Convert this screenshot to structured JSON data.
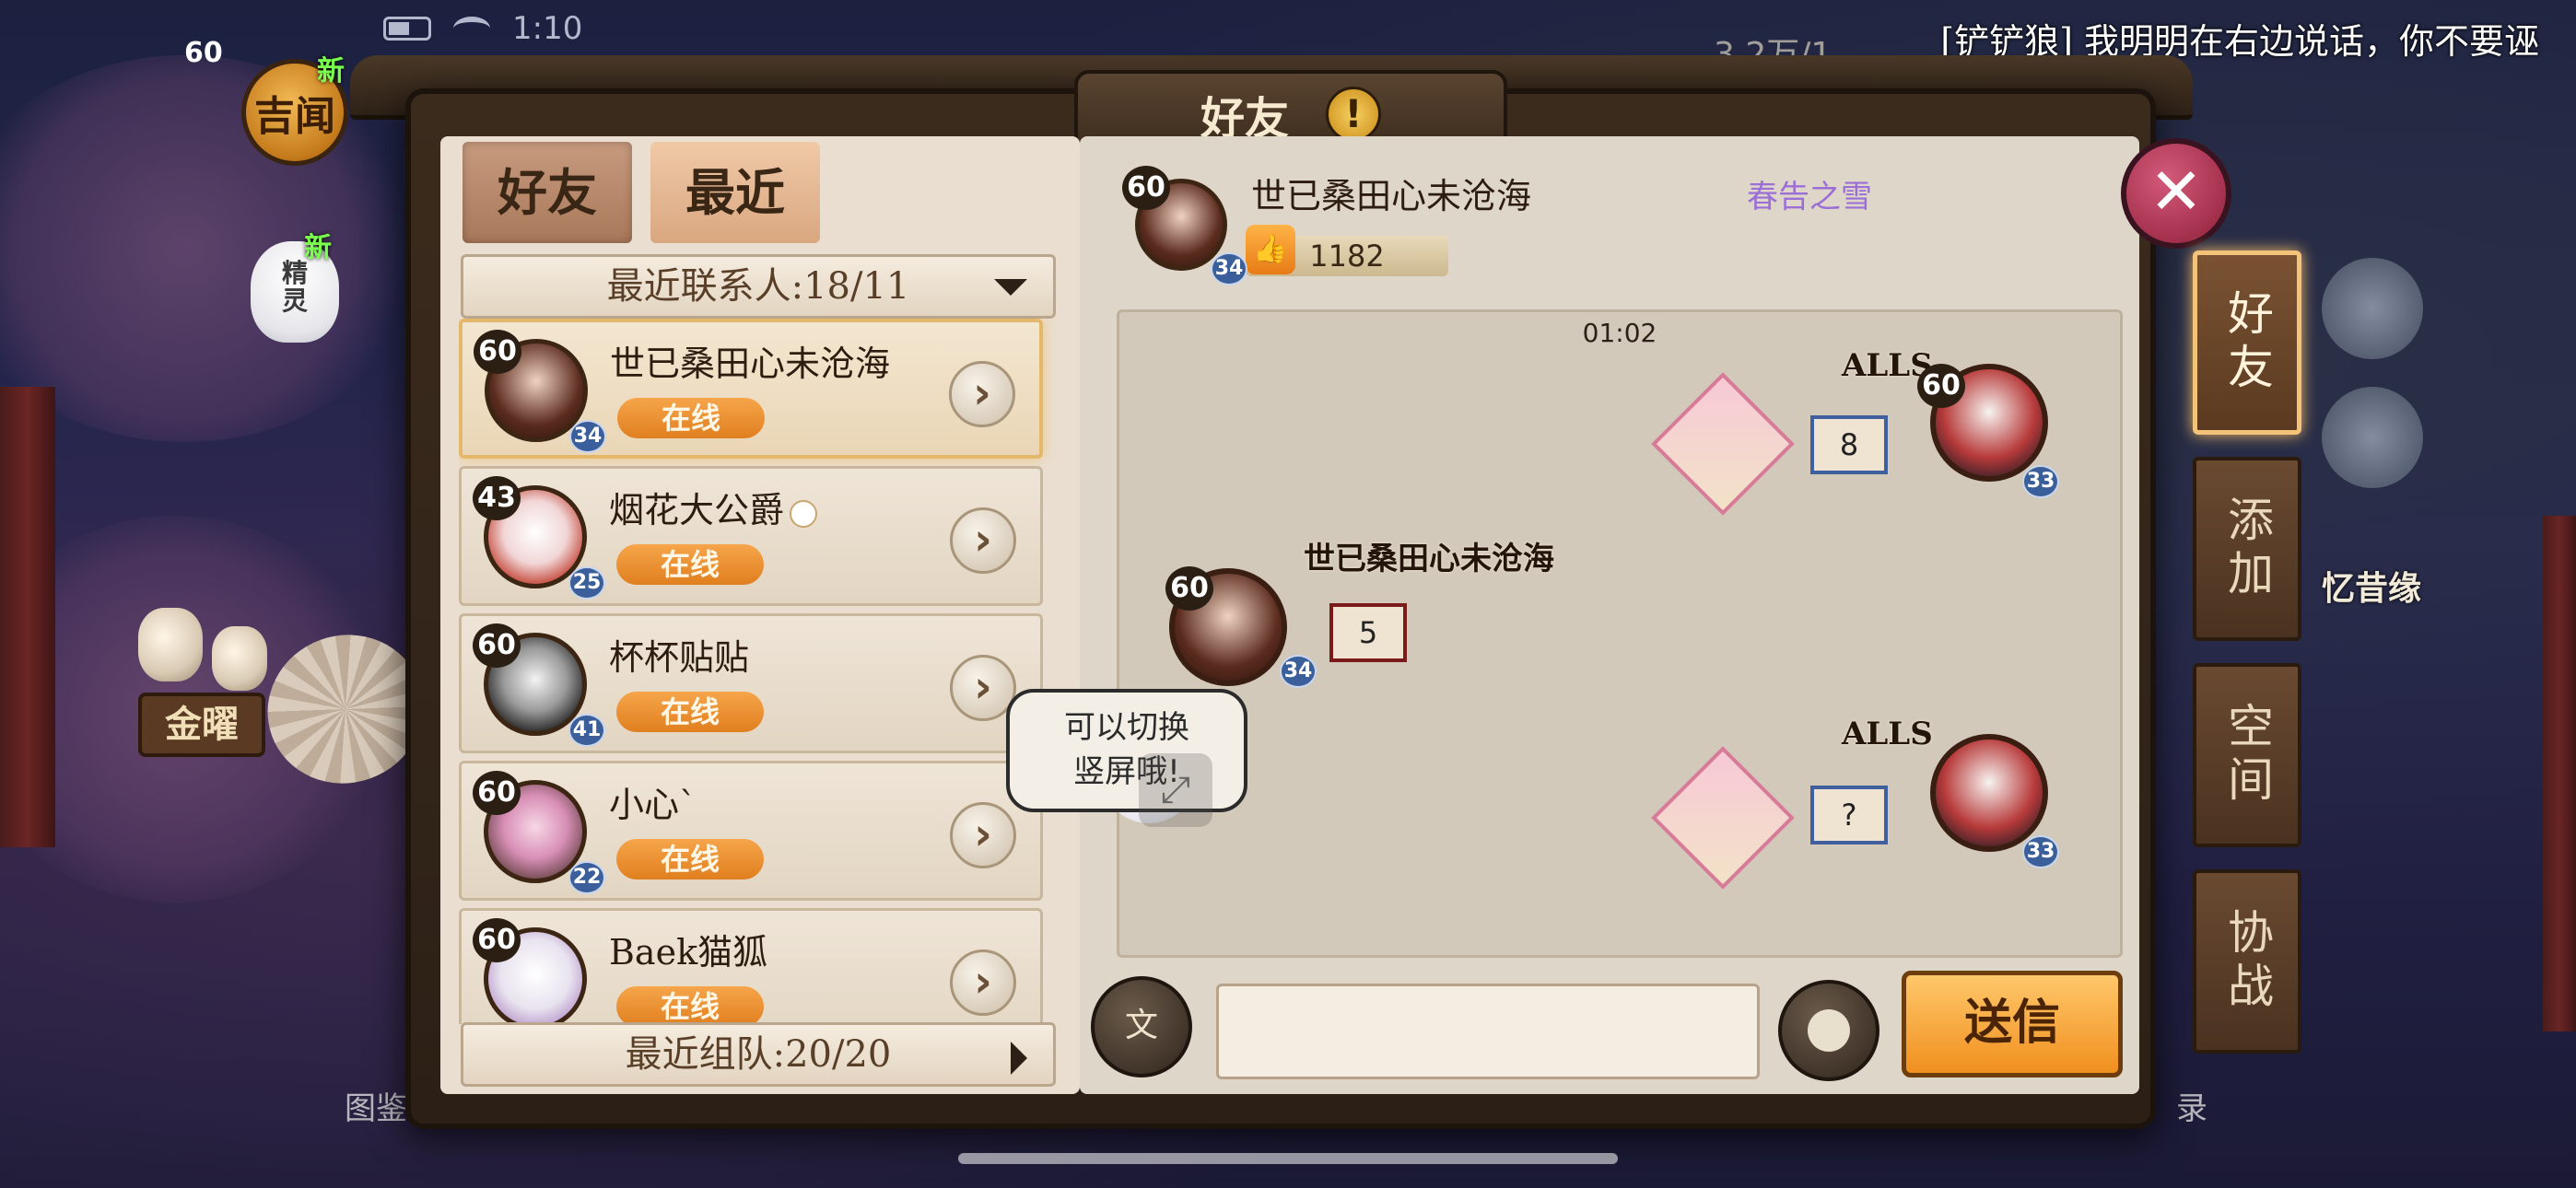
{
  "status_bar": {
    "time": "1:10"
  },
  "top_left": {
    "level": "60",
    "jiwen_label": "吉闻",
    "jiwen_new": "新",
    "spirit_label": "精\n灵",
    "spirit_new": "新"
  },
  "top_resource": "3.2万/1",
  "broadcast": "[铲铲狼] 我明明在右边说话，你不要诬",
  "background": {
    "sign_text": "金曜",
    "bottom_left_label": "图鉴",
    "right_label": "忆昔缘",
    "bottom_right_label": "录"
  },
  "dialog": {
    "title": "好友",
    "warn_symbol": "!",
    "close_symbol": "✕"
  },
  "left": {
    "tabs": [
      {
        "label": "好友",
        "active": false
      },
      {
        "label": "最近",
        "active": true
      }
    ],
    "recent_contacts_label": "最近联系人:18/11",
    "recent_team_label": "最近组队:20/20",
    "friends": [
      {
        "name": "世已桑田心未沧海",
        "level": "60",
        "sub_level": "34",
        "status": "在线",
        "selected": true
      },
      {
        "name": "烟花大公爵",
        "level": "43",
        "sub_level": "25",
        "status": "在线",
        "selected": false
      },
      {
        "name": "杯杯贴贴",
        "level": "60",
        "sub_level": "41",
        "status": "在线",
        "selected": false
      },
      {
        "name": "小心`",
        "level": "60",
        "sub_level": "22",
        "status": "在线",
        "selected": false
      },
      {
        "name": "Baek猫狐",
        "level": "60",
        "sub_level": "",
        "status": "在线",
        "selected": false
      }
    ],
    "chevron": "›"
  },
  "chat": {
    "header": {
      "name": "世已桑田心未沧海",
      "level": "60",
      "sub_level": "34",
      "title": "春告之雪",
      "likes": "1182"
    },
    "time": "01:02",
    "messages": [
      {
        "sender": "ALLS",
        "side": "right",
        "level": "60",
        "sub_level": "33",
        "text": "8"
      },
      {
        "sender": "世已桑田心未沧海",
        "side": "left",
        "level": "60",
        "sub_level": "34",
        "text": "5"
      },
      {
        "sender": "ALLS",
        "side": "right",
        "level": "60",
        "sub_level": "33",
        "text": "?"
      }
    ],
    "switch_tip": "可以切换\n竖屏哦!",
    "voice_label": "文",
    "input_value": "",
    "input_placeholder": "",
    "send_label": "送信"
  },
  "side_tabs": [
    {
      "label": "好友",
      "active": true
    },
    {
      "label": "添加",
      "active": false
    },
    {
      "label": "空间",
      "active": false
    },
    {
      "label": "协战",
      "active": false
    }
  ],
  "colors": {
    "online_pill": "#e07f1f",
    "accent_gold": "#f3c37a",
    "title_purple": "#9b6fd6",
    "bubble_blue": "#3f5f9f",
    "bubble_red": "#7a1a1a"
  },
  "icons": [
    "warn-icon",
    "close-icon",
    "chevron-right-icon",
    "chevron-down-icon",
    "thumbs-up-icon",
    "voice-to-text-icon",
    "emoji-icon",
    "rotate-screen-icon"
  ]
}
